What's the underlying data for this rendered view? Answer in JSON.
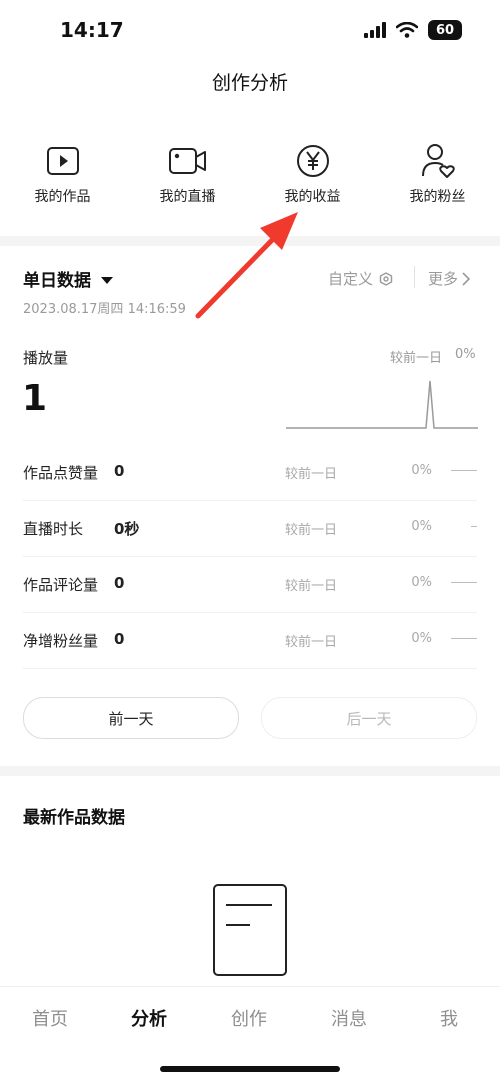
{
  "status_bar": {
    "time": "14:17",
    "battery": "60"
  },
  "header": {
    "title": "创作分析"
  },
  "quick_nav": [
    {
      "label": "我的作品",
      "icon": "play-square-icon"
    },
    {
      "label": "我的直播",
      "icon": "video-camera-icon"
    },
    {
      "label": "我的收益",
      "icon": "yen-circle-icon"
    },
    {
      "label": "我的粉丝",
      "icon": "user-heart-icon"
    }
  ],
  "daily": {
    "title": "单日数据",
    "customize_label": "自定义",
    "more_label": "更多",
    "timestamp": "2023.08.17周四 14:16:59",
    "plays": {
      "label": "播放量",
      "value": "1",
      "compare_label": "较前一日",
      "compare_pct": "0%"
    },
    "metrics": [
      {
        "name": "作品点赞量",
        "value": "0",
        "compare": "较前一日",
        "pct": "0%"
      },
      {
        "name": "直播时长",
        "value": "0秒",
        "compare": "较前一日",
        "pct": "0%"
      },
      {
        "name": "作品评论量",
        "value": "0",
        "compare": "较前一日",
        "pct": "0%"
      },
      {
        "name": "净增粉丝量",
        "value": "0",
        "compare": "较前一日",
        "pct": "0%"
      }
    ],
    "prev_day_label": "前一天",
    "next_day_label": "后一天"
  },
  "latest": {
    "title": "最新作品数据"
  },
  "tabbar": {
    "tabs": [
      {
        "label": "首页"
      },
      {
        "label": "分析"
      },
      {
        "label": "创作"
      },
      {
        "label": "消息"
      },
      {
        "label": "我"
      }
    ],
    "active_index": 1
  },
  "colors": {
    "annotation_arrow": "#f03a2e",
    "muted_text": "#9a9a9a",
    "band": "#f4f4f4"
  }
}
